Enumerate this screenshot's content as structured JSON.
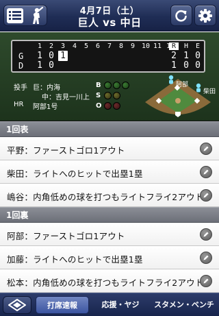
{
  "header": {
    "date": "4月7日（土）",
    "matchup": "巨人 vs 中日",
    "menu_icon": "list-icon",
    "batter_icon": "batter-silhouette-icon",
    "refresh_icon": "refresh-icon",
    "settings_icon": "gear-icon"
  },
  "scoreboard": {
    "innings": [
      "1",
      "2",
      "3",
      "4",
      "5",
      "6",
      "7",
      "8",
      "9",
      "10",
      "11",
      "12"
    ],
    "rhe_headers": [
      "R",
      "H",
      "E"
    ],
    "teams": [
      {
        "label": "G",
        "scores": [
          "1",
          "0",
          "1"
        ],
        "current_inning_index": 2,
        "rhe": [
          "2",
          "1",
          "0"
        ]
      },
      {
        "label": "D",
        "scores": [
          "1",
          "0"
        ],
        "current_inning_index": -1,
        "rhe": [
          "1",
          "0",
          "0"
        ]
      }
    ]
  },
  "info": {
    "pitcher_label": "投手",
    "pitcher_home": "巨：内海",
    "pitcher_away": "中：吉見一川上",
    "hr_label": "HR",
    "hr_value": "阿部1号"
  },
  "count": {
    "labels": [
      "B",
      "S",
      "O"
    ],
    "balls": 0,
    "strikes": 0,
    "outs": 0
  },
  "field": {
    "runners": [
      "阿部",
      "柴田"
    ]
  },
  "sections": [
    {
      "title": "1回表",
      "plays": [
        "平野：ファーストゴロ1アウト",
        "柴田：ライトへのヒットで出塁1塁",
        "嶋谷：内角低めの球を打つもライトフライ2アウト"
      ]
    },
    {
      "title": "1回裏",
      "plays": [
        "阿部：ファーストゴロ1アウト",
        "加藤：ライトへのヒットで出塁1塁",
        "松本：内角低めの球を打つもライトフライ2アウト"
      ]
    }
  ],
  "tabbar": {
    "home_icon": "stadium-icon",
    "tabs": [
      "打席速報",
      "応援・ヤジ",
      "スタメン・ベンチ"
    ],
    "active_index": 0
  }
}
